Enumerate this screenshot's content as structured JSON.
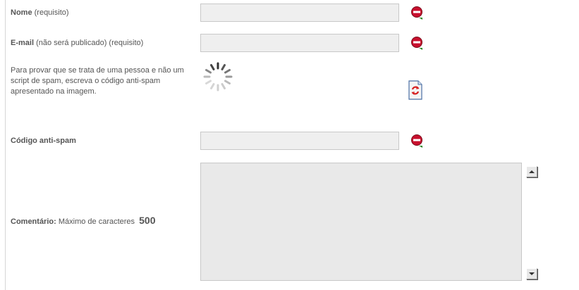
{
  "form": {
    "name": {
      "label_bold": "Nome",
      "label_note": "(requisito)",
      "value": ""
    },
    "email": {
      "label_bold": "E-mail",
      "label_note": "(não será publicado) (requisito)",
      "value": ""
    },
    "captcha": {
      "instructions": "Para provar que se trata de uma pessoa e não um script de spam, escreva o código anti-spam apresentado na imagem.",
      "loading_icon": "loading-spinner-icon",
      "refresh_icon": "refresh-icon"
    },
    "antispam": {
      "label_bold": "Código anti-spam",
      "value": ""
    },
    "comment": {
      "label_bold": "Comentário:",
      "label_note": "Máximo de caracteres",
      "max_chars": "500",
      "value": ""
    },
    "error_icon": "error-icon"
  },
  "colors": {
    "error_red": "#c8102e",
    "field_bg": "#efefef",
    "field_border": "#c8c8c8"
  }
}
